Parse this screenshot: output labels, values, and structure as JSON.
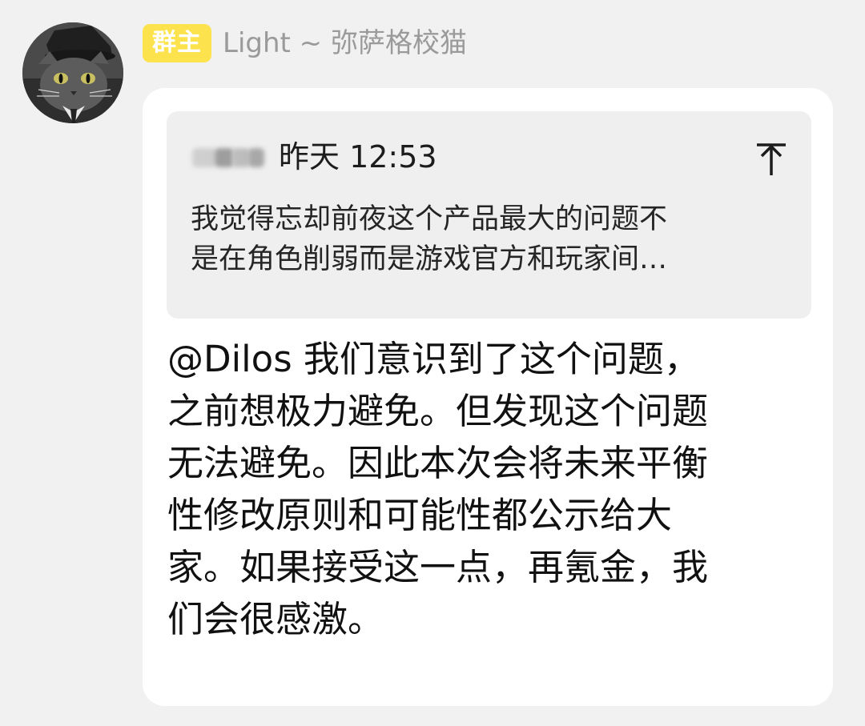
{
  "sender": {
    "role_badge": "群主",
    "name": "Light ~ 弥萨格校猫"
  },
  "quote": {
    "time": "昨天 12:53",
    "text": "我觉得忘却前夜这个产品最大的问题不\n是在角色削弱而是游戏官方和玩家间…",
    "scroll_icon": "scroll-to-top-icon"
  },
  "message": {
    "text": "@Dilos 我们意识到了这个问题，\n之前想极力避免。但发现这个问题\n无法避免。因此本次会将未来平衡\n性修改原则和可能性都公示给大\n家。如果接受这一点，再氪金，我\n们会很感激。"
  },
  "colors": {
    "badge_bg": "#fce34d",
    "background": "#f1f1f1",
    "bubble": "#ffffff",
    "quote_bg": "#efefef",
    "name_text": "#9a9a9a"
  }
}
